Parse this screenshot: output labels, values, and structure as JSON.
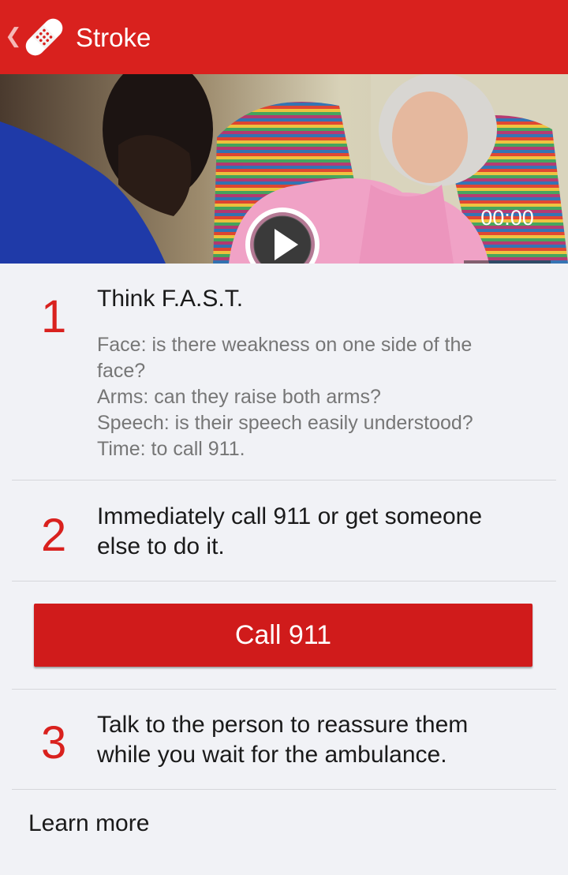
{
  "app_bar": {
    "title": "Stroke",
    "back_icon": "chevron-left-icon",
    "logo_icon": "bandage-icon",
    "background": "#d9211e"
  },
  "video": {
    "time": "00:00",
    "play_icon": "play-icon"
  },
  "steps": [
    {
      "number": "1",
      "heading": "Think F.A.S.T.",
      "details": [
        "Face: is there weakness on one side of the",
        "face?",
        "Arms: can they raise both arms?",
        "Speech: is their speech easily understood?",
        "Time: to call 911."
      ]
    },
    {
      "number": "2",
      "heading_lines": [
        "Immediately call 911 or get someone",
        "else to do it."
      ]
    },
    {
      "number": "3",
      "heading_lines": [
        "Talk to the person to reassure them",
        "while you wait for the ambulance."
      ]
    }
  ],
  "call_button": {
    "label": "Call 911",
    "color": "#d01b1b"
  },
  "learn_more": "Learn more"
}
